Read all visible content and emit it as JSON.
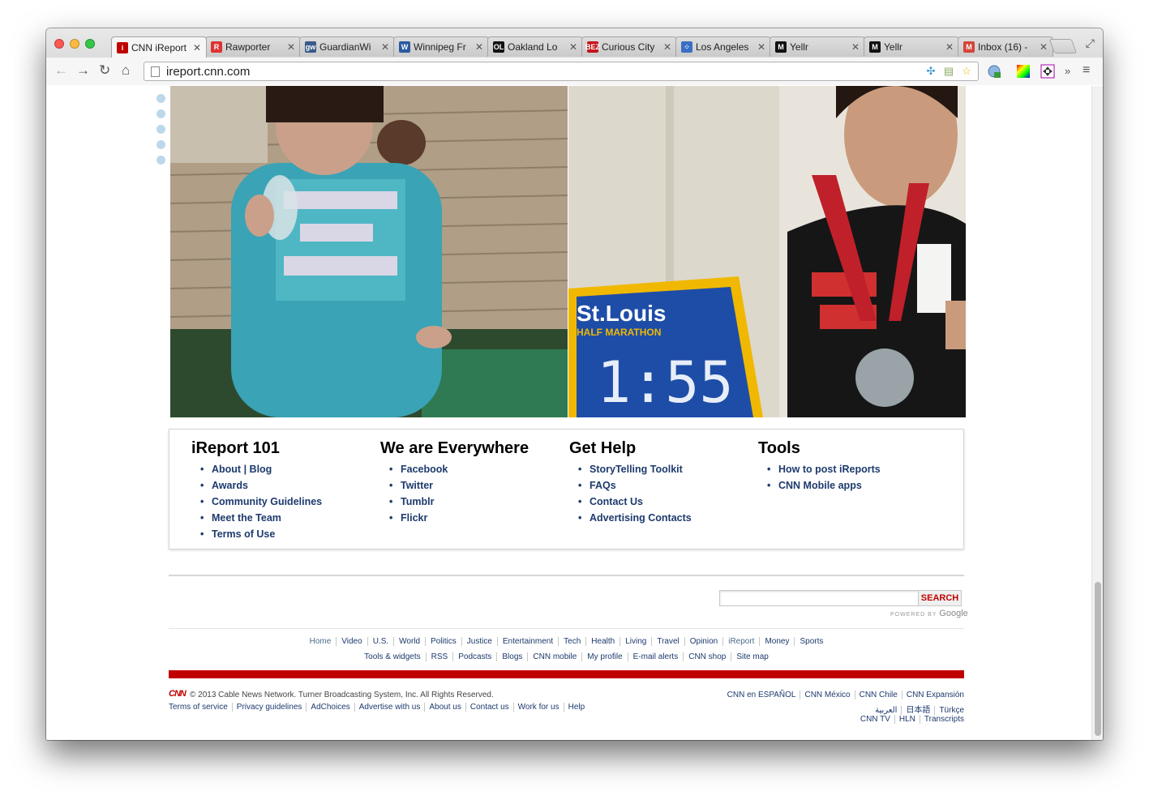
{
  "browser": {
    "tabs": [
      {
        "title": "CNN iReport",
        "fav": "i",
        "favcolor": "#c00000"
      },
      {
        "title": "Rawporter",
        "fav": "R",
        "favcolor": "#d33"
      },
      {
        "title": "GuardianWi",
        "fav": "gw",
        "favcolor": "#3a5a8a"
      },
      {
        "title": "Winnipeg Fr",
        "fav": "W",
        "favcolor": "#2a5aa0"
      },
      {
        "title": "Oakland Lo",
        "fav": "OL",
        "favcolor": "#111111"
      },
      {
        "title": "Curious City",
        "fav": "BEZ",
        "favcolor": "#c4161c"
      },
      {
        "title": "Los Angeles",
        "fav": "⁘",
        "favcolor": "#3a6fc4"
      },
      {
        "title": "Yellr",
        "fav": "M",
        "favcolor": "#111111"
      },
      {
        "title": "Yellr",
        "fav": "M",
        "favcolor": "#111111"
      },
      {
        "title": "Inbox (16) -",
        "fav": "M",
        "favcolor": "#d44638"
      }
    ],
    "url": "ireport.cnn.com"
  },
  "footer": {
    "columns": [
      {
        "heading": "iReport 101",
        "links": [
          "About | Blog",
          "Awards",
          "Community Guidelines",
          "Meet the Team",
          "Terms of Use"
        ]
      },
      {
        "heading": "We are Everywhere",
        "links": [
          "Facebook",
          "Twitter",
          "Tumblr",
          "Flickr"
        ]
      },
      {
        "heading": "Get Help",
        "links": [
          "StoryTelling Toolkit",
          "FAQs",
          "Contact Us",
          "Advertising Contacts"
        ]
      },
      {
        "heading": "Tools",
        "links": [
          "How to post iReports",
          "CNN Mobile apps"
        ]
      }
    ]
  },
  "search": {
    "button": "SEARCH",
    "powered_by": "POWERED BY",
    "google": "Google"
  },
  "nav1": [
    "Home",
    "Video",
    "U.S.",
    "World",
    "Politics",
    "Justice",
    "Entertainment",
    "Tech",
    "Health",
    "Living",
    "Travel",
    "Opinion",
    "iReport",
    "Money",
    "Sports"
  ],
  "nav2": [
    "Tools & widgets",
    "RSS",
    "Podcasts",
    "Blogs",
    "CNN mobile",
    "My profile",
    "E-mail alerts",
    "CNN shop",
    "Site map"
  ],
  "bottom": {
    "logo": "CNN",
    "copyright": "© 2013 Cable News Network. Turner Broadcasting System, Inc. All Rights Reserved.",
    "links": [
      "Terms of service",
      "Privacy guidelines",
      "AdChoices",
      "Advertise with us",
      "About us",
      "Contact us",
      "Work for us",
      "Help"
    ],
    "intl1": [
      "CNN en ESPAÑOL",
      "CNN México",
      "CNN Chile",
      "CNN Expansión"
    ],
    "intl2": [
      "العربية",
      "日本語",
      "Türkçe"
    ],
    "intl3": [
      "CNN TV",
      "HLN",
      "Transcripts"
    ]
  },
  "photos": {
    "sign_text": "St.Louis",
    "sign_sub": "HALF MARATHON",
    "clock": "1:55"
  }
}
